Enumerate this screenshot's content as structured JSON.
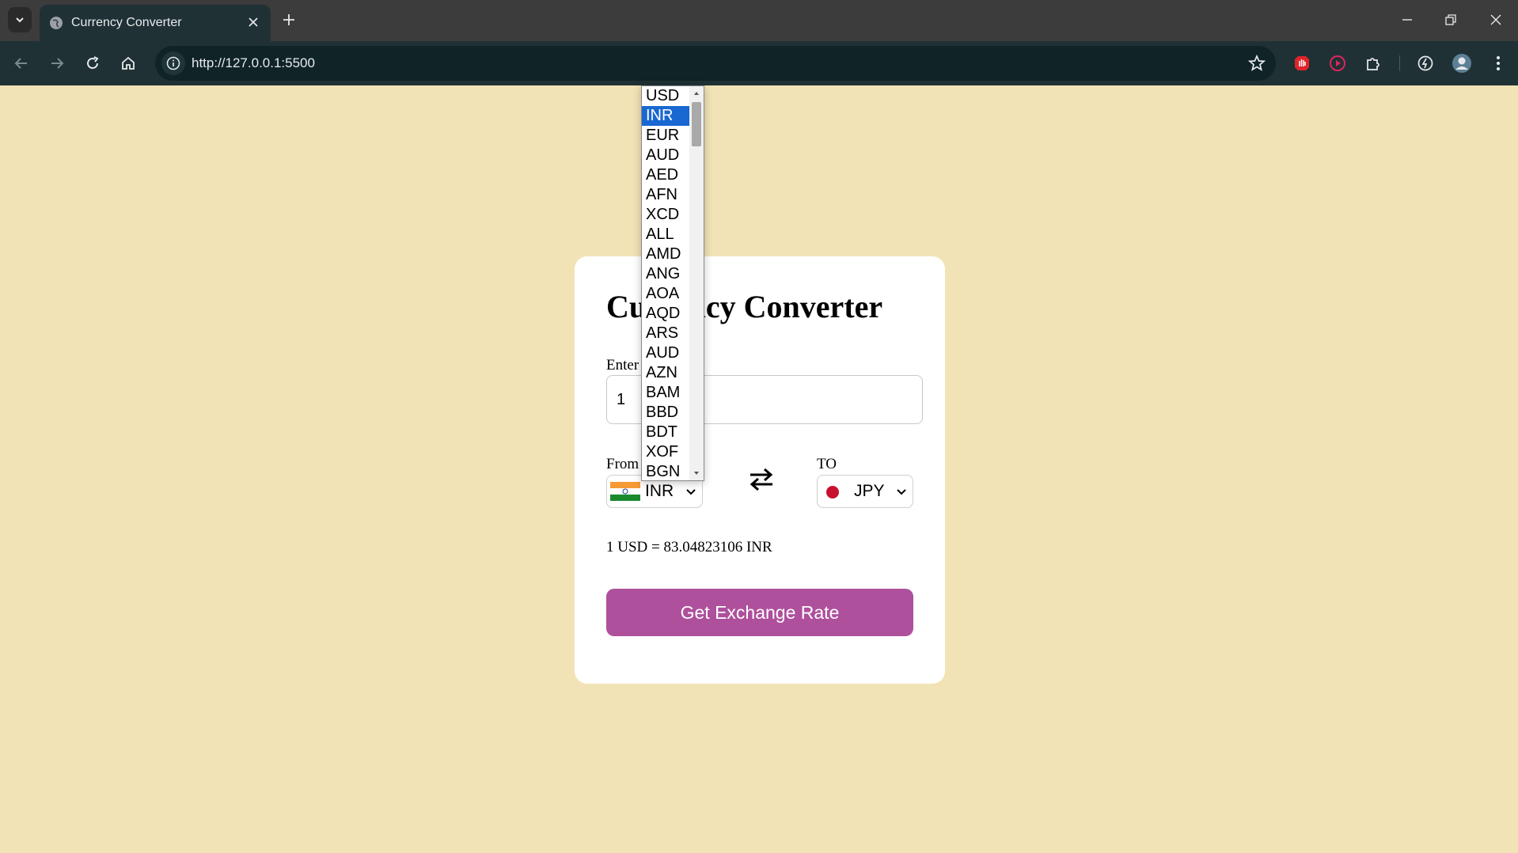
{
  "browser": {
    "tab_title": "Currency Converter",
    "url": "http://127.0.0.1:5500"
  },
  "page": {
    "title": "Currency Converter",
    "amount_label": "Enter Amount",
    "amount_value": "1",
    "from_label": "From",
    "to_label": "TO",
    "from_currency": "INR",
    "to_currency": "JPY",
    "rate_text": "1 USD = 83.04823106 INR",
    "button_label": "Get Exchange Rate"
  },
  "dropdown": {
    "selected": "INR",
    "options": [
      "USD",
      "INR",
      "EUR",
      "AUD",
      "AED",
      "AFN",
      "XCD",
      "ALL",
      "AMD",
      "ANG",
      "AOA",
      "AQD",
      "ARS",
      "AUD",
      "AZN",
      "BAM",
      "BBD",
      "BDT",
      "XOF",
      "BGN"
    ]
  },
  "colors": {
    "page_bg": "#f2e3b6",
    "button_bg": "#ae509c",
    "selected_option": "#1967d2"
  }
}
